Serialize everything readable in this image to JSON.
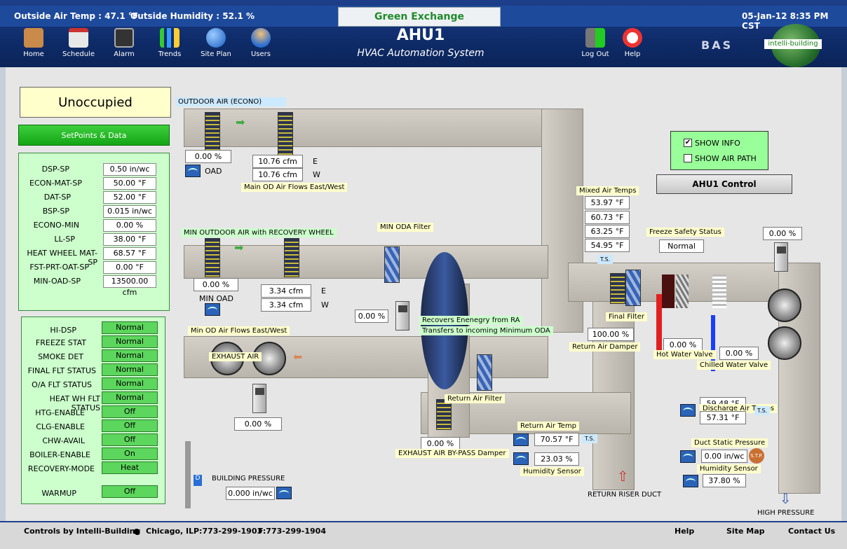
{
  "header": {
    "outside_temp": "Outside Air Temp : 47.1 °F",
    "outside_humidity": "Outside Humidity : 52.1 %",
    "site_name": "Green Exchange",
    "title": "AHU1",
    "subtitle": "HVAC Automation System",
    "datetime": "05-Jan-12 8:35 PM CST",
    "brand_short": "BAS",
    "brand_name": "intelli-building"
  },
  "nav": [
    {
      "label": "Home",
      "icon": "home-icon"
    },
    {
      "label": "Schedule",
      "icon": "calendar-icon"
    },
    {
      "label": "Alarm",
      "icon": "alarm-icon"
    },
    {
      "label": "Trends",
      "icon": "chart-icon"
    },
    {
      "label": "Site Plan",
      "icon": "globe-icon"
    },
    {
      "label": "Users",
      "icon": "users-icon"
    },
    {
      "label": "Log Out",
      "icon": "logout-icon"
    },
    {
      "label": "Help",
      "icon": "lifebuoy-icon"
    }
  ],
  "mode": "Unoccupied",
  "setpoints_button": "SetPoints & Data",
  "setpoints": [
    {
      "label": "DSP-SP",
      "value": "0.50 in/wc"
    },
    {
      "label": "ECON-MAT-SP",
      "value": "50.00 °F"
    },
    {
      "label": "DAT-SP",
      "value": "52.00 °F"
    },
    {
      "label": "BSP-SP",
      "value": "0.015 in/wc"
    },
    {
      "label": "ECONO-MIN",
      "value": "0.00 %"
    },
    {
      "label": "LL-SP",
      "value": "38.00 °F"
    },
    {
      "label": "HEAT WHEEL MAT-SP",
      "value": "68.57 °F"
    },
    {
      "label": "FST-PRT-OAT-SP",
      "value": "0.00 °F"
    },
    {
      "label": "MIN-OAD-SP",
      "value": "13500.00 cfm"
    }
  ],
  "statuses": [
    {
      "label": "HI-DSP",
      "value": "Normal"
    },
    {
      "label": "FREEZE STAT",
      "value": "Normal"
    },
    {
      "label": "SMOKE DET",
      "value": "Normal"
    },
    {
      "label": "FINAL FLT STATUS",
      "value": "Normal"
    },
    {
      "label": "O/A FLT STATUS",
      "value": "Normal"
    },
    {
      "label": "HEAT WH FLT STATUS",
      "value": "Normal"
    },
    {
      "label": "HTG-ENABLE",
      "value": "Off"
    },
    {
      "label": "CLG-ENABLE",
      "value": "Off"
    },
    {
      "label": "CHW-AVAIL",
      "value": "Off"
    },
    {
      "label": "BOILER-ENABLE",
      "value": "On"
    },
    {
      "label": "RECOVERY-MODE",
      "value": "Heat"
    },
    {
      "label": "WARMUP",
      "value": "Off"
    }
  ],
  "options": {
    "show_info": "SHOW INFO",
    "show_air_path": "SHOW AIR PATH",
    "control_button": "AHU1 Control"
  },
  "diagram": {
    "outdoor_air_label": "OUTDOOR AIR (ECONO)",
    "oad_pct": "0.00 %",
    "oad_label": "OAD",
    "main_flow_e": "10.76 cfm",
    "main_flow_w": "10.76 cfm",
    "east": "E",
    "west": "W",
    "main_flow_label": "Main OD Air Flows East/West",
    "min_oa_label": "MIN OUTDOOR AIR with RECOVERY WHEEL",
    "min_oda_filter": "MIN ODA Filter",
    "min_oad_pct": "0.00 %",
    "min_oad_label": "MIN OAD",
    "min_flow_e": "3.34 cfm",
    "min_flow_w": "3.34 cfm",
    "wheel_ctrl_pct": "0.00 %",
    "recovers_label": "Recovers Enenegry from RA",
    "transfers_label": "Transfers to incoming Minimum ODA",
    "min_flow_label": "Min OD Air Flows East/West",
    "exhaust_label": "EXHAUST AIR",
    "exhaust_pct": "0.00 %",
    "mixed_air_label": "Mixed Air Temps",
    "mixed_air_temps": [
      "53.97 °F",
      "60.73 °F",
      "63.25 °F",
      "54.95 °F"
    ],
    "freeze_label": "Freeze Safety Status",
    "freeze_value": "Normal",
    "final_filter": "Final Filter",
    "return_damper_pct": "100.00 %",
    "return_damper_label": "Return Air Damper",
    "hw_valve_pct": "0.00 %",
    "hw_valve_label": "Hot Water Valve",
    "chw_valve_pct": "0.00 %",
    "chw_valve_label": "Chilled Water Valve",
    "supply_fan_pct": "0.00 %",
    "return_filter": "Return Air Filter",
    "bypass_pct": "0.00 %",
    "bypass_label": "EXHAUST AIR BY-PASS Damper",
    "return_temp_label": "Return Air Temp",
    "return_temp": "70.57 °F",
    "return_humidity": "23.03 %",
    "humidity_sensor_label": "Humidity Sensor",
    "return_riser": "RETURN RISER DUCT",
    "discharge_label": "Discharge Air Temps",
    "discharge_temps": [
      "59.48 °F",
      "57.31 °F"
    ],
    "duct_static_label": "Duct Static Pressure",
    "duct_static": "0.00 in/wc",
    "supply_humidity_label": "Humidity Sensor",
    "supply_humidity": "37.80 %",
    "high_pressure": "HIGH PRESSURE",
    "building_pressure_label": "BUILDING PRESSURE",
    "building_pressure": "0.000 in/wc",
    "ts": "T.S.",
    "stp": "S.T.P."
  },
  "footer": {
    "company": "Controls by Intelli-Building",
    "location": "Chicago, IL",
    "phone": "P:773-299-1903",
    "fax": "F:773-299-1904",
    "help": "Help",
    "site_map": "Site Map",
    "contact": "Contact Us"
  }
}
